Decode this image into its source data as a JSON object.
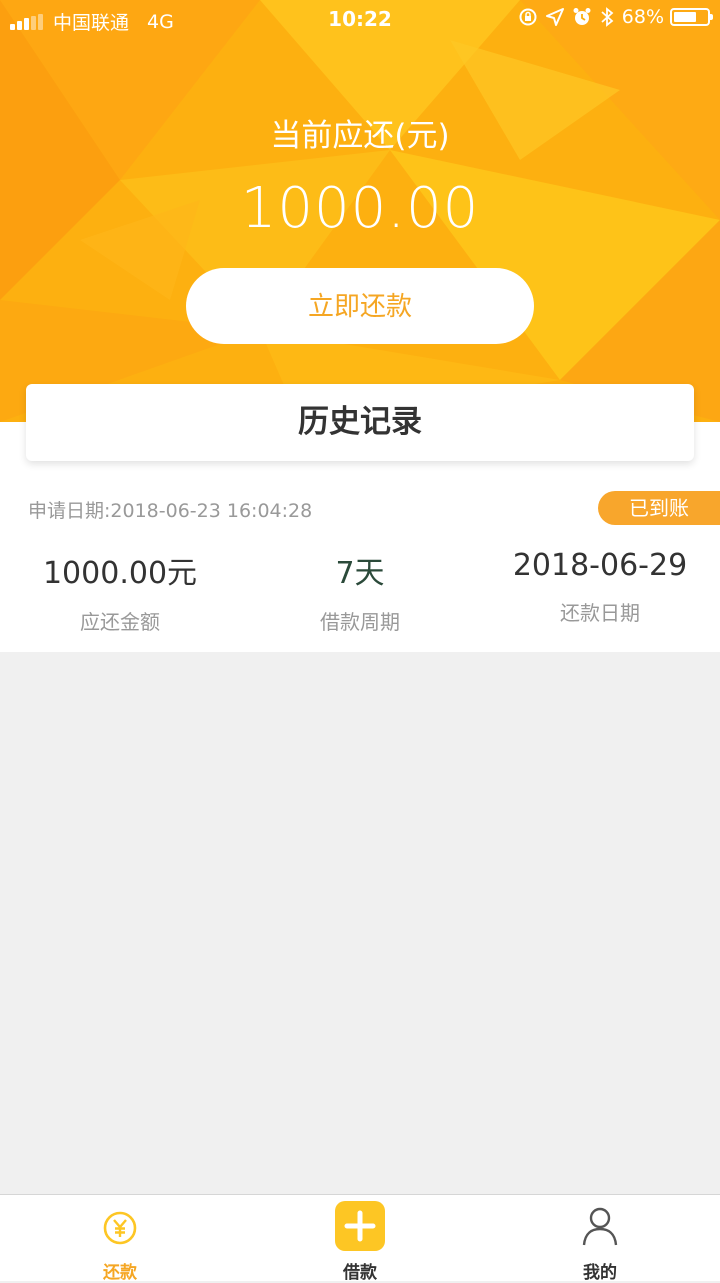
{
  "status_bar": {
    "carrier": "中国联通",
    "network": "4G",
    "time": "10:22",
    "battery_percent": "68%",
    "battery_level": 0.68,
    "signal_bars_filled": 3,
    "signal_bars_total": 5,
    "icons": [
      "rotation-lock-icon",
      "location-icon",
      "alarm-icon",
      "bluetooth-icon",
      "battery-icon"
    ]
  },
  "header": {
    "due_label": "当前应还(元)",
    "due_amount": "1000.00",
    "repay_button": "立即还款",
    "background_color": "#fdb010"
  },
  "history": {
    "title": "历史记录",
    "records": [
      {
        "apply_date": "申请日期:2018-06-23 16:04:28",
        "status": "已到账",
        "amount": "1000.00元",
        "amount_label": "应还金额",
        "period": "7天",
        "period_label": "借款周期",
        "repay_date": "2018-06-29",
        "repay_date_label": "还款日期"
      }
    ]
  },
  "tabbar": {
    "tabs": [
      {
        "label": "还款",
        "icon": "yuan-circle-icon",
        "active": true
      },
      {
        "label": "借款",
        "icon": "plus-icon",
        "active": false
      },
      {
        "label": "我的",
        "icon": "user-icon",
        "active": false
      }
    ],
    "active_color": "#f5a623"
  }
}
